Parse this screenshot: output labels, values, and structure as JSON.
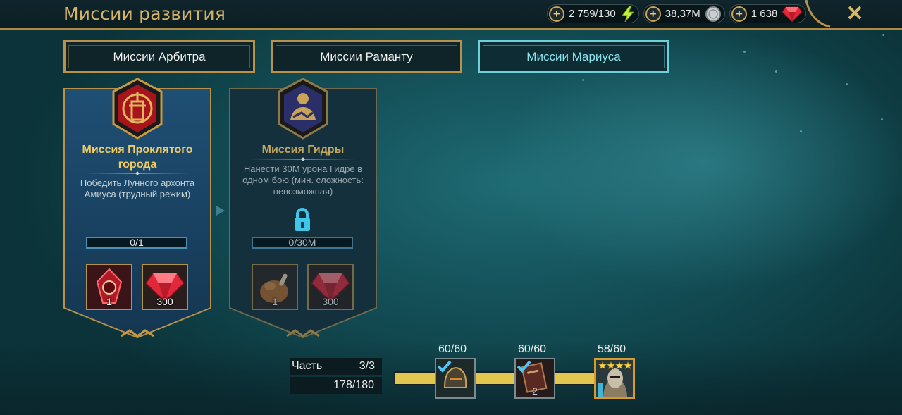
{
  "header": {
    "title": "Миссии развития",
    "resources": [
      {
        "name": "energy",
        "value": "2 759/130",
        "icon": "lightning-icon"
      },
      {
        "name": "silver",
        "value": "38,37M",
        "icon": "silver-coin-icon"
      },
      {
        "name": "gems",
        "value": "1 638",
        "icon": "ruby-gem-icon"
      }
    ],
    "close_icon": "✕"
  },
  "tabs": [
    {
      "label": "Миссии Арбитра",
      "active": false
    },
    {
      "label": "Миссии Раманту",
      "active": false
    },
    {
      "label": "Миссии Мариуса",
      "active": true
    }
  ],
  "missions": [
    {
      "title": "Миссия Проклятого города",
      "description": "Победить Лунного архонта Амиуса (трудный режим)",
      "progress": "0/1",
      "locked": false,
      "emblem": "cursed-city-emblem-icon",
      "rewards": [
        {
          "icon": "shard-artifact-icon",
          "count": "1"
        },
        {
          "icon": "ruby-gem-icon",
          "count": "300"
        }
      ]
    },
    {
      "title": "Миссия Гидры",
      "description": "Нанести 30M урона Гидре в одном бою (мин. сложность: невозможная)",
      "progress": "0/30M",
      "locked": true,
      "emblem": "handshake-emblem-icon",
      "rewards": [
        {
          "icon": "roast-chicken-icon",
          "count": "1"
        },
        {
          "icon": "ruby-gem-icon",
          "count": "300"
        }
      ]
    }
  ],
  "footer": {
    "part_label": "Часть",
    "part_value": "3/3",
    "points": "178/180",
    "milestones": [
      {
        "label": "60/60",
        "icon": "helmet-artifact-icon",
        "claimed": true,
        "count": ""
      },
      {
        "label": "60/60",
        "icon": "book-icon",
        "claimed": true,
        "count": "2"
      },
      {
        "label": "58/60",
        "icon": "champion-portrait-icon",
        "claimed": false,
        "stars": 4,
        "count": ""
      }
    ]
  },
  "colors": {
    "gold": "#b8914a",
    "title_gold": "#d4b26a",
    "active_tab": "#6ed0da",
    "progress_fill": "#e2c74e"
  }
}
